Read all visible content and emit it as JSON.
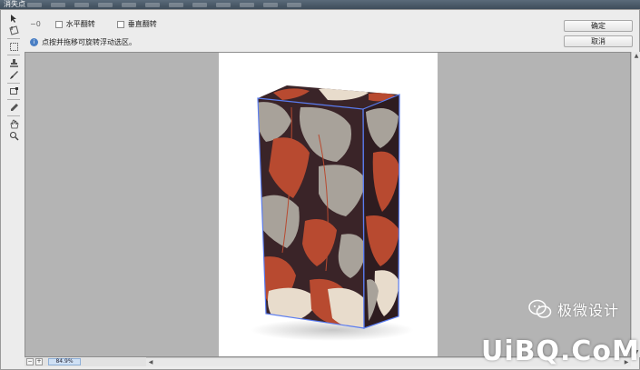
{
  "window": {
    "title": "消失点"
  },
  "options": {
    "tool_indicator": "−0",
    "flip_horizontal_label": "水平翻转",
    "flip_vertical_label": "垂直翻转",
    "hint_text": "点按并拖移可旋转浮动选区。"
  },
  "buttons": {
    "ok_label": "确定",
    "cancel_label": "取消"
  },
  "status": {
    "zoom": "84.9%"
  },
  "watermark": {
    "text": "极微设计",
    "site": "UiBQ.CoM"
  },
  "colors": {
    "grid_outline": "#5a7cf0",
    "pattern_dark": "#3a2428",
    "pattern_rust": "#b84a30",
    "pattern_grey": "#a8a29a",
    "pattern_cream": "#e8dccc"
  },
  "icons": [
    "edit-plane-icon",
    "create-plane-icon",
    "marquee-icon",
    "stamp-icon",
    "brush-icon",
    "transform-icon",
    "eyedropper-icon",
    "hand-icon",
    "zoom-icon"
  ]
}
